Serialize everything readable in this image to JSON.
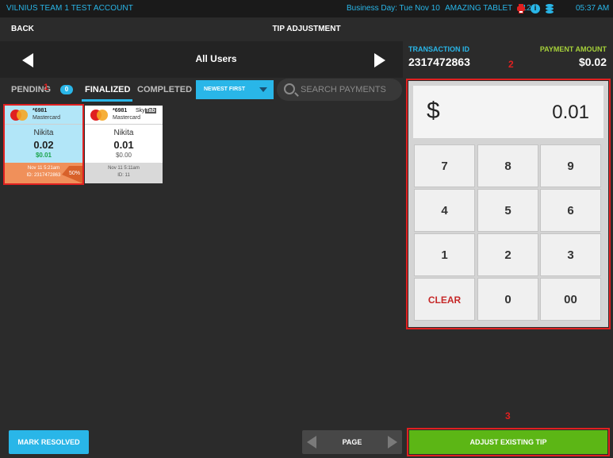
{
  "status_bar": {
    "account": "VILNIUS TEAM 1 TEST ACCOUNT",
    "business_day": "Business Day: Tue Nov 10",
    "device": "AMAZING TABLET",
    "device_number": "#128",
    "info_glyph": "i",
    "time": "05:37 AM",
    "icons": [
      "printer-icon",
      "info-icon",
      "database-icon"
    ]
  },
  "header": {
    "back_label": "BACK",
    "title": "TIP ADJUSTMENT"
  },
  "user_nav": {
    "current_user": "All Users"
  },
  "transaction": {
    "id_label": "TRANSACTION ID",
    "id_value": "2317472863",
    "amount_label": "PAYMENT AMOUNT",
    "amount_value": "$0.02"
  },
  "annotations": {
    "one": "1",
    "two": "2",
    "three": "3"
  },
  "tabs": {
    "pending": "PENDING",
    "pending_count": "0",
    "finalized": "FINALIZED",
    "completed": "COMPLETED",
    "active": "finalized"
  },
  "sort": {
    "selected": "NEWEST FIRST"
  },
  "search": {
    "placeholder": "SEARCH PAYMENTS",
    "value": ""
  },
  "payments": [
    {
      "last4": "*6981",
      "brand": "Mastercard",
      "user": "Nikita",
      "amount": "0.02",
      "tip": "$0.01",
      "time": "Nov 11 5:21am",
      "id": "ID: 2317472863",
      "tip_percent": "50%",
      "selected": true
    },
    {
      "last4": "*6981",
      "brand": "Mastercard",
      "source_prefix": "Sky",
      "source_suffix": "Tab",
      "user": "Nikita",
      "amount": "0.01",
      "tip": "$0.00",
      "time": "Nov 11 5:11am",
      "id": "ID: 11",
      "selected": false
    }
  ],
  "keypad": {
    "currency": "$",
    "display_value": "0.01",
    "keys": [
      "7",
      "8",
      "9",
      "4",
      "5",
      "6",
      "1",
      "2",
      "3",
      "CLEAR",
      "0",
      "00"
    ]
  },
  "footer": {
    "mark_resolved_label": "MARK RESOLVED",
    "page_label": "PAGE",
    "adjust_label": "ADJUST EXISTING TIP"
  },
  "colors": {
    "accent_blue": "#29b6e8",
    "accent_green": "#5cb615",
    "annotation_red": "#e02020",
    "amount_label_green": "#a6d13a"
  }
}
